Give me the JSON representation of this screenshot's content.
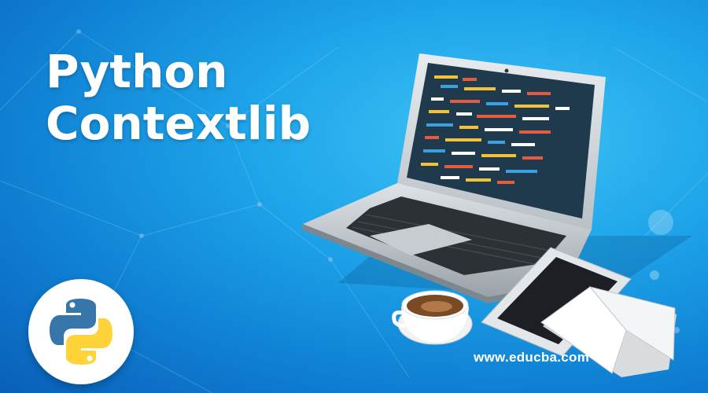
{
  "banner": {
    "title_line1": "Python",
    "title_line2": "Contextlib",
    "site_url": "www.educba.com"
  },
  "colors": {
    "background_accent": "#1ea5ea",
    "title_text": "#ffffff",
    "python_blue": "#3776ab",
    "python_yellow": "#ffd43b"
  },
  "icons": [
    "python-logo-icon",
    "laptop-illustration",
    "coffee-cup-illustration",
    "tablet-illustration",
    "open-book-illustration"
  ]
}
